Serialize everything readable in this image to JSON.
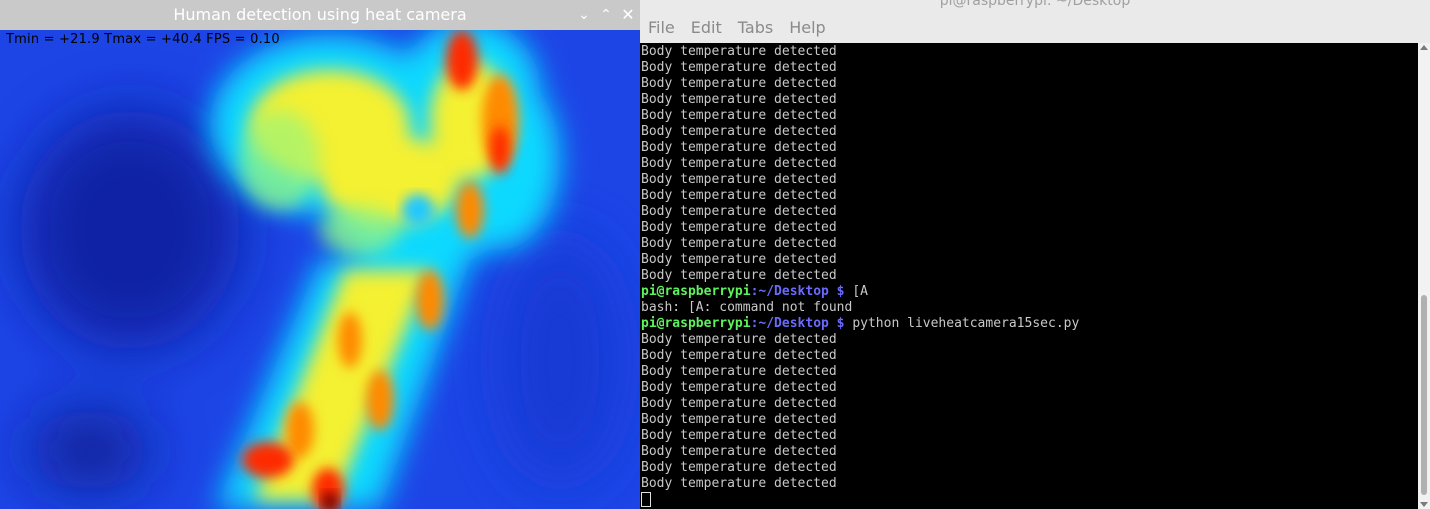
{
  "heat_window": {
    "title": "Human detection using heat camera",
    "overlay": "Tmin = +21.9 Tmax = +40.4 FPS = 0.10",
    "controls": {
      "minimize": "⌄",
      "maximize": "⌃",
      "close": "✕"
    }
  },
  "terminal": {
    "title": "pi@raspberrypi: ~/Desktop",
    "menu": [
      "File",
      "Edit",
      "Tabs",
      "Help"
    ],
    "lines": [
      {
        "type": "out",
        "text": "Body temperature detected"
      },
      {
        "type": "out",
        "text": "Body temperature detected"
      },
      {
        "type": "out",
        "text": "Body temperature detected"
      },
      {
        "type": "out",
        "text": "Body temperature detected"
      },
      {
        "type": "out",
        "text": "Body temperature detected"
      },
      {
        "type": "out",
        "text": "Body temperature detected"
      },
      {
        "type": "out",
        "text": "Body temperature detected"
      },
      {
        "type": "out",
        "text": "Body temperature detected"
      },
      {
        "type": "out",
        "text": "Body temperature detected"
      },
      {
        "type": "out",
        "text": "Body temperature detected"
      },
      {
        "type": "out",
        "text": "Body temperature detected"
      },
      {
        "type": "out",
        "text": "Body temperature detected"
      },
      {
        "type": "out",
        "text": "Body temperature detected"
      },
      {
        "type": "out",
        "text": "Body temperature detected"
      },
      {
        "type": "out",
        "text": "Body temperature detected"
      },
      {
        "type": "prompt",
        "user": "pi@raspberrypi",
        "path": ":~/Desktop $",
        "cmd": " [A"
      },
      {
        "type": "out",
        "text": "bash: [A: command not found"
      },
      {
        "type": "prompt",
        "user": "pi@raspberrypi",
        "path": ":~/Desktop $",
        "cmd": " python liveheatcamera15sec.py"
      },
      {
        "type": "out",
        "text": "Body temperature detected"
      },
      {
        "type": "out",
        "text": "Body temperature detected"
      },
      {
        "type": "out",
        "text": "Body temperature detected"
      },
      {
        "type": "out",
        "text": "Body temperature detected"
      },
      {
        "type": "out",
        "text": "Body temperature detected"
      },
      {
        "type": "out",
        "text": "Body temperature detected"
      },
      {
        "type": "out",
        "text": "Body temperature detected"
      },
      {
        "type": "out",
        "text": "Body temperature detected"
      },
      {
        "type": "out",
        "text": "Body temperature detected"
      },
      {
        "type": "out",
        "text": "Body temperature detected"
      }
    ]
  },
  "colors": {
    "heat_cold": "#1b3fe0",
    "heat_cool": "#00e6ff",
    "heat_warm": "#ffff20",
    "heat_hot": "#ff2000",
    "heat_max": "#6a0000",
    "prompt_user": "#5ff25f",
    "prompt_path": "#6a6aff"
  }
}
